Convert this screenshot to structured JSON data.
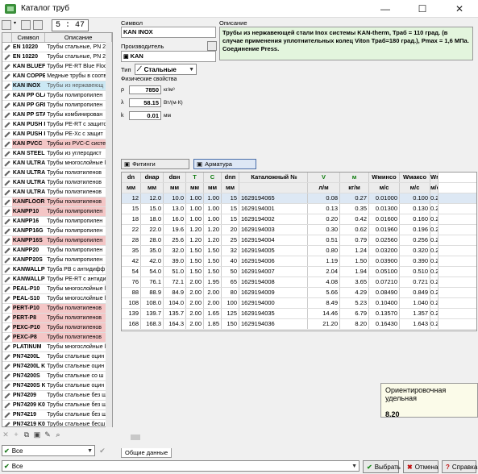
{
  "window": {
    "title": "Каталог труб",
    "minimize": "—",
    "maximize": "☐",
    "close": "✕"
  },
  "left": {
    "timer": "5 : 47",
    "columns": [
      "Символ",
      "Описание"
    ],
    "rows": [
      {
        "sym": "EN 10220",
        "desc": "Трубы стальные, PN 2",
        "style": ""
      },
      {
        "sym": "EN 10220",
        "desc": "Трубы стальные, PN 2",
        "style": ""
      },
      {
        "sym": "KAN BLUEFL",
        "desc": "Трубы PE-RT Blue Floor",
        "style": ""
      },
      {
        "sym": "KAN COPPER",
        "desc": "Медные трубы в соотв",
        "style": ""
      },
      {
        "sym": "KAN INOX",
        "desc": "Трубы из нержавеющ",
        "style": "sel"
      },
      {
        "sym": "KAN PP GLA",
        "desc": "Трубы полипропилен",
        "style": ""
      },
      {
        "sym": "KAN PP GRE",
        "desc": "Трубы полипропилен",
        "style": ""
      },
      {
        "sym": "KAN PP STA",
        "desc": "Трубы комбинирован",
        "style": ""
      },
      {
        "sym": "KAN PUSH P",
        "desc": "Трубы PE-RT с защито",
        "style": ""
      },
      {
        "sym": "KAN PUSH P",
        "desc": "Трубы PE-Xc с защит",
        "style": ""
      },
      {
        "sym": "KAN PVCC",
        "desc": "Трубы из PVC-C систе",
        "style": "pink"
      },
      {
        "sym": "KAN STEEL",
        "desc": "Трубы из углеродист",
        "style": ""
      },
      {
        "sym": "KAN ULTRAI",
        "desc": "Трубы многослойные l",
        "style": ""
      },
      {
        "sym": "KAN ULTRAI",
        "desc": "Трубы полиэтиленов",
        "style": ""
      },
      {
        "sym": "KAN ULTRAI",
        "desc": "Трубы полиэтиленов",
        "style": ""
      },
      {
        "sym": "KAN ULTRAI",
        "desc": "Трубы полиэтиленов",
        "style": ""
      },
      {
        "sym": "KANFLOOR",
        "desc": "Трубы полиэтиленов",
        "style": "pink"
      },
      {
        "sym": "KANPP10",
        "desc": "Трубы полипропилен",
        "style": "pink"
      },
      {
        "sym": "KANPP16",
        "desc": "Трубы полипропилен",
        "style": ""
      },
      {
        "sym": "KANPP16G",
        "desc": "Трубы полипропилен",
        "style": ""
      },
      {
        "sym": "KANPP16S",
        "desc": "Трубы полипропилен",
        "style": "pink"
      },
      {
        "sym": "KANPP20",
        "desc": "Трубы полипропилен",
        "style": ""
      },
      {
        "sym": "KANPP20S",
        "desc": "Трубы полипропилен",
        "style": ""
      },
      {
        "sym": "KANWALLPE",
        "desc": "Труба PB с антидифф",
        "style": ""
      },
      {
        "sym": "KANWALLPE",
        "desc": "Трубы PE-RT с антиди",
        "style": ""
      },
      {
        "sym": "PEAL-P10",
        "desc": "Трубы многослойные l",
        "style": ""
      },
      {
        "sym": "PEAL-S10",
        "desc": "Трубы многослойные l",
        "style": ""
      },
      {
        "sym": "PERT-P10",
        "desc": "Трубы полиэтиленов",
        "style": "pink"
      },
      {
        "sym": "PERT-P8",
        "desc": "Трубы полиэтиленов",
        "style": "pink"
      },
      {
        "sym": "PEXC-P10",
        "desc": "Трубы полиэтиленов",
        "style": "pink"
      },
      {
        "sym": "PEXC-P8",
        "desc": "Трубы полиэтиленов",
        "style": "pink"
      },
      {
        "sym": "PLATINUM",
        "desc": "Трубы многослойные l",
        "style": ""
      },
      {
        "sym": "PN74200L",
        "desc": "Трубы стальные оцин",
        "style": ""
      },
      {
        "sym": "PN74200L K",
        "desc": "Трубы стальные оцин",
        "style": ""
      },
      {
        "sym": "PN74200S",
        "desc": "Трубы стальные со ш",
        "style": ""
      },
      {
        "sym": "PN74200S K",
        "desc": "Трубы стальные оцин",
        "style": ""
      },
      {
        "sym": "PN74209",
        "desc": "Трубы стальные без ш",
        "style": ""
      },
      {
        "sym": "PN74209 K0",
        "desc": "Трубы стальные без ш",
        "style": ""
      },
      {
        "sym": "PN74219",
        "desc": "Трубы стальные без ш",
        "style": ""
      },
      {
        "sym": "PN74219 K0",
        "desc": "Трубы стальные бесш",
        "style": ""
      }
    ],
    "filter1": "Все",
    "filter2": "Все"
  },
  "right": {
    "symbol_label": "Символ",
    "symbol_value": "KAN INOX",
    "desc_label": "Описание",
    "desc_value": "Трубы из нержавеющей стали Inox системы KAN-therm, Траб = 110 град. (в случае применения  уплотнительных колец Viton  Траб=180 град.),  Pmax = 1,6 МПа. Соединение Press.",
    "producer_label": "Производитель",
    "producer_value": "KAN",
    "type_label": "Тип",
    "type_value": "Стальные",
    "phys_label": "Физические свойства",
    "rho_sym": "ρ",
    "rho": "7850",
    "rho_unit": "кг/м³",
    "lambda_sym": "λ",
    "lambda": "58.15",
    "lambda_unit": "Вт/(м·К)",
    "k_sym": "k",
    "k": "0.01",
    "k_unit": "мм",
    "tab_fittings": "Фитинги",
    "tab_armatura": "Арматура"
  },
  "grid": {
    "headers": [
      "dn",
      "dнар",
      "dвн",
      "T",
      "C",
      "dnп",
      "Каталожный №",
      "V",
      "м",
      "Wминсо",
      "Wмаксо",
      "Wм"
    ],
    "units": [
      "мм",
      "мм",
      "мм",
      "мм",
      "мм",
      "мм",
      "",
      "л/м",
      "кг/м",
      "м/с",
      "м/с",
      "м/с"
    ],
    "rows": [
      [
        "12",
        "12.0",
        "10.0",
        "1.00",
        "1.00",
        "15",
        "1629194065",
        "0.08",
        "0.27",
        "0.01000",
        "0.100",
        "0.2"
      ],
      [
        "15",
        "15.0",
        "13.0",
        "1.00",
        "1.00",
        "15",
        "1629194001",
        "0.13",
        "0.35",
        "0.01300",
        "0.130",
        "0.2"
      ],
      [
        "18",
        "18.0",
        "16.0",
        "1.00",
        "1.00",
        "15",
        "1629194002",
        "0.20",
        "0.42",
        "0.01600",
        "0.160",
        "0.2"
      ],
      [
        "22",
        "22.0",
        "19.6",
        "1.20",
        "1.20",
        "20",
        "1629194003",
        "0.30",
        "0.62",
        "0.01960",
        "0.196",
        "0.2"
      ],
      [
        "28",
        "28.0",
        "25.6",
        "1.20",
        "1.20",
        "25",
        "1629194004",
        "0.51",
        "0.79",
        "0.02560",
        "0.256",
        "0.2"
      ],
      [
        "35",
        "35.0",
        "32.0",
        "1.50",
        "1.50",
        "32",
        "1629194005",
        "0.80",
        "1.24",
        "0.03200",
        "0.320",
        "0.2"
      ],
      [
        "42",
        "42.0",
        "39.0",
        "1.50",
        "1.50",
        "40",
        "1629194006",
        "1.19",
        "1.50",
        "0.03900",
        "0.390",
        "0.2"
      ],
      [
        "54",
        "54.0",
        "51.0",
        "1.50",
        "1.50",
        "50",
        "1629194007",
        "2.04",
        "1.94",
        "0.05100",
        "0.510",
        "0.2"
      ],
      [
        "76",
        "76.1",
        "72.1",
        "2.00",
        "1.95",
        "65",
        "1629194008",
        "4.08",
        "3.65",
        "0.07210",
        "0.721",
        "0.2"
      ],
      [
        "88",
        "88.9",
        "84.9",
        "2.00",
        "2.00",
        "80",
        "1629194009",
        "5.66",
        "4.29",
        "0.08490",
        "0.849",
        "0.2"
      ],
      [
        "108",
        "108.0",
        "104.0",
        "2.00",
        "2.00",
        "100",
        "1629194000",
        "8.49",
        "5.23",
        "0.10400",
        "1.040",
        "0.2"
      ],
      [
        "139",
        "139.7",
        "135.7",
        "2.00",
        "1.65",
        "125",
        "1629194035",
        "14.46",
        "6.79",
        "0.13570",
        "1.357",
        "0.2"
      ],
      [
        "168",
        "168.3",
        "164.3",
        "2.00",
        "1.85",
        "150",
        "1629194036",
        "21.20",
        "8.20",
        "0.16430",
        "1.643",
        "0.2"
      ]
    ]
  },
  "tooltip": {
    "title": "Ориентировочная удельная",
    "value": "8.20"
  },
  "bottom": {
    "tab": "Общие данные",
    "ok": "Выбрать",
    "cancel": "Отмена",
    "help": "Справка"
  }
}
